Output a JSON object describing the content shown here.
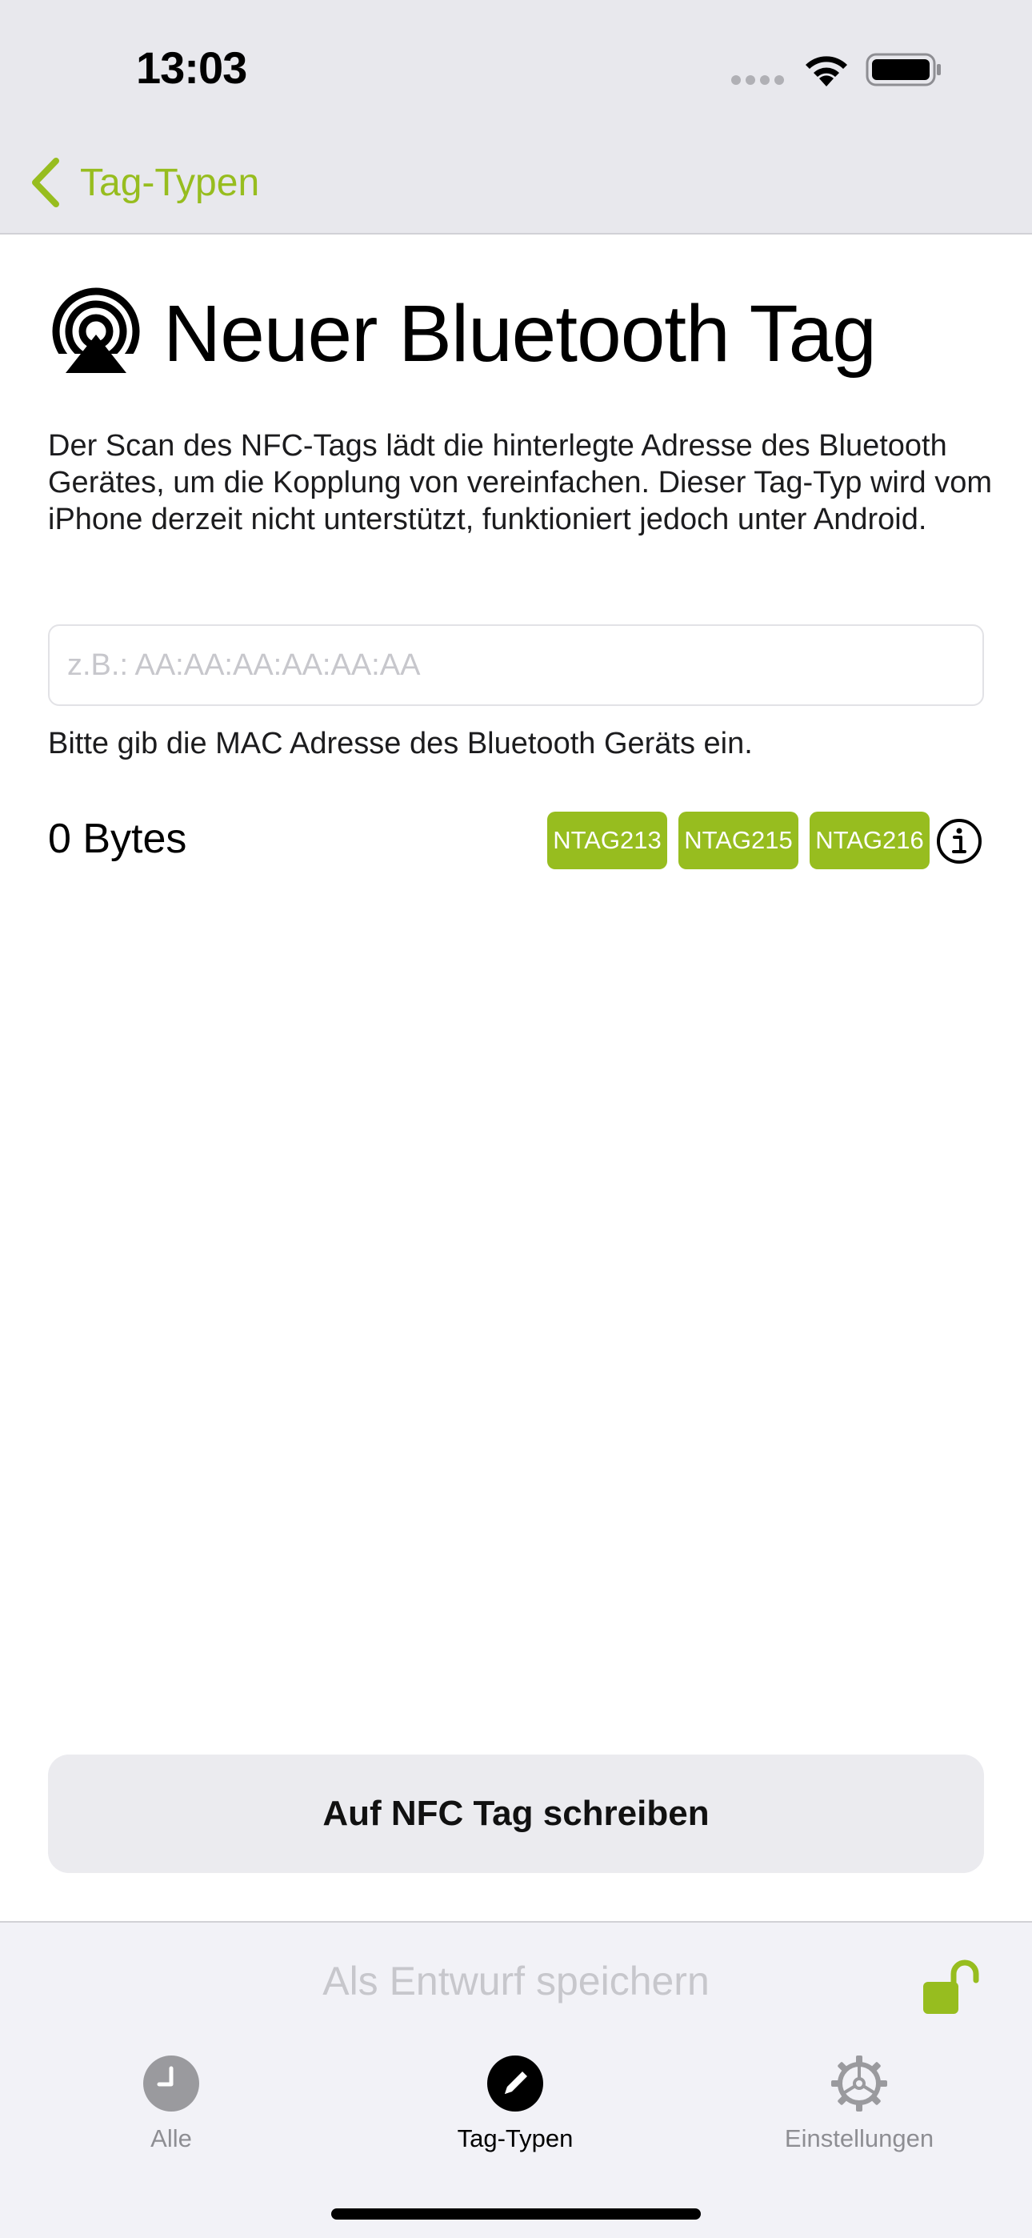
{
  "status_bar": {
    "time": "13:03"
  },
  "nav": {
    "back_label": "Tag-Typen"
  },
  "page": {
    "title": "Neuer Bluetooth Tag",
    "description": "Der Scan des NFC-Tags lädt die hinterlegte Adresse des Bluetooth Gerätes, um die Kopplung von vereinfachen. Dieser Tag-Typ wird vom iPhone derzeit nicht unterstützt, funktioniert jedoch unter Android."
  },
  "mac_input": {
    "value": "",
    "placeholder": "z.B.: AA:AA:AA:AA:AA:AA",
    "hint": "Bitte gib die MAC Adresse des Bluetooth Geräts ein."
  },
  "size": {
    "bytes_label": "0 Bytes",
    "chips": [
      "NTAG213",
      "NTAG215",
      "NTAG216"
    ]
  },
  "actions": {
    "write_label": "Auf NFC Tag schreiben",
    "draft_label": "Als Entwurf speichern"
  },
  "tabbar": {
    "items": [
      {
        "label": "Alle",
        "icon": "clock-icon"
      },
      {
        "label": "Tag-Typen",
        "icon": "pencil-icon",
        "active": true
      },
      {
        "label": "Einstellungen",
        "icon": "gear-icon"
      }
    ]
  },
  "colors": {
    "accent": "#97bd1f",
    "header_bg": "#e8e8ed",
    "button_bg": "#ebebef",
    "tabbar_bg": "#f2f2f7"
  }
}
